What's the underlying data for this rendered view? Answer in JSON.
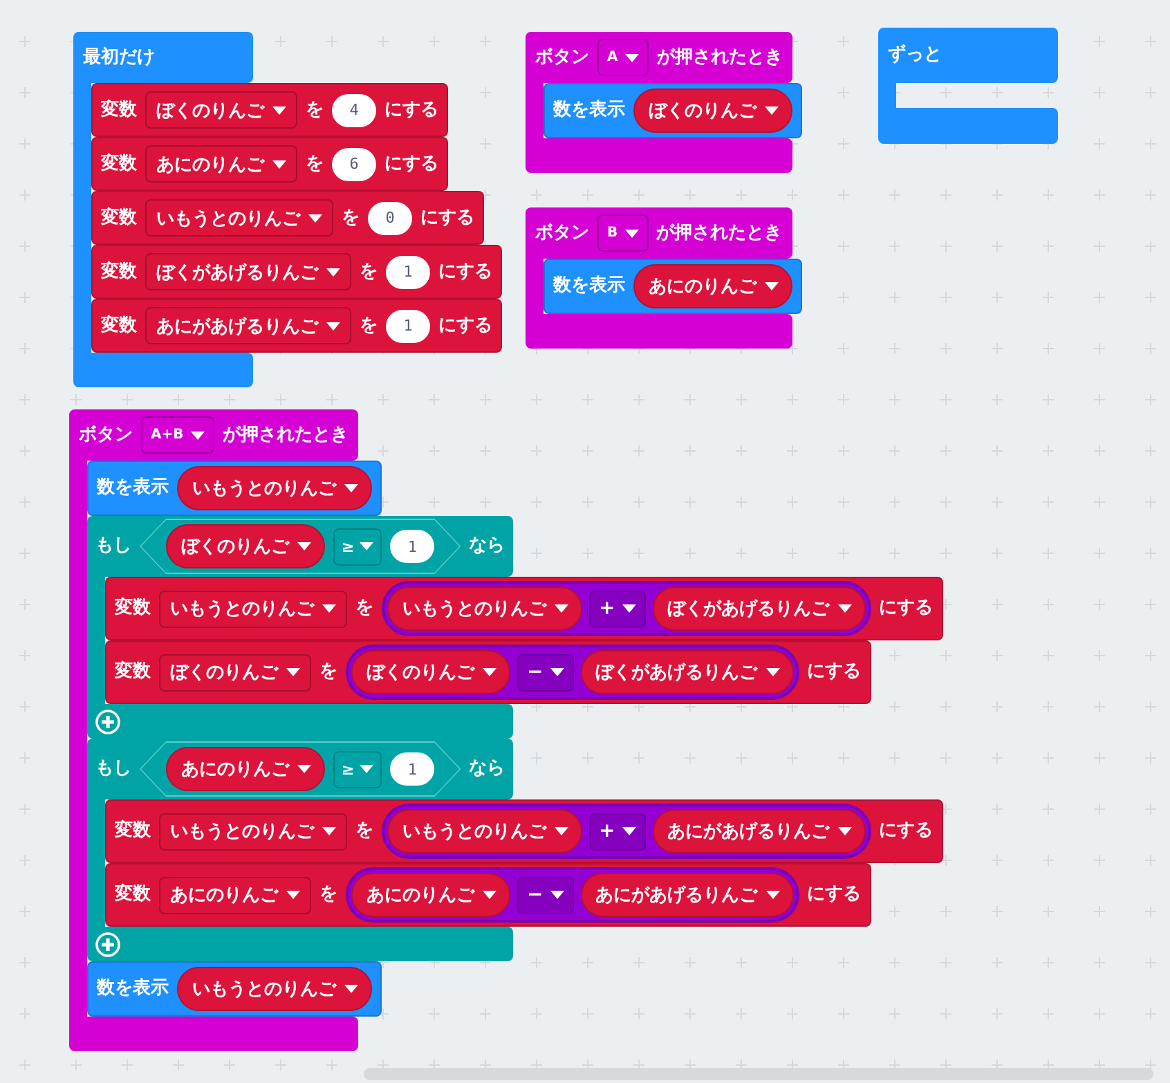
{
  "scripts": [
    {
      "kind": "on_start",
      "label": "最初だけ",
      "body": [
        {
          "kind": "set",
          "label": "変数",
          "variable": "ぼくのりんご",
          "word": "を",
          "value": {
            "kind": "number",
            "text": "4"
          },
          "suffix": "にする"
        },
        {
          "kind": "set",
          "label": "変数",
          "variable": "あにのりんご",
          "word": "を",
          "value": {
            "kind": "number",
            "text": "6"
          },
          "suffix": "にする"
        },
        {
          "kind": "set",
          "label": "変数",
          "variable": "いもうとのりんご",
          "word": "を",
          "value": {
            "kind": "number",
            "text": "0"
          },
          "suffix": "にする"
        },
        {
          "kind": "set",
          "label": "変数",
          "variable": "ぼくがあげるりんご",
          "word": "を",
          "value": {
            "kind": "number",
            "text": "1"
          },
          "suffix": "にする"
        },
        {
          "kind": "set",
          "label": "変数",
          "variable": "あにがあげるりんご",
          "word": "を",
          "value": {
            "kind": "number",
            "text": "1"
          },
          "suffix": "にする"
        }
      ]
    },
    {
      "kind": "on_button",
      "label": "ボタン",
      "button": "A",
      "suffix": "が押されたとき",
      "body": [
        {
          "kind": "show_number",
          "label": "数を表示",
          "value": {
            "kind": "variable",
            "name": "ぼくのりんご"
          }
        }
      ]
    },
    {
      "kind": "forever",
      "label": "ずっと"
    },
    {
      "kind": "on_button",
      "label": "ボタン",
      "button": "B",
      "suffix": "が押されたとき",
      "body": [
        {
          "kind": "show_number",
          "label": "数を表示",
          "value": {
            "kind": "variable",
            "name": "あにのりんご"
          }
        }
      ]
    },
    {
      "kind": "on_button",
      "label": "ボタン",
      "button": "A+B",
      "suffix": "が押されたとき",
      "body": [
        {
          "kind": "show_number",
          "label": "数を表示",
          "value": {
            "kind": "variable",
            "name": "いもうとのりんご"
          }
        },
        {
          "kind": "if",
          "label": "もし",
          "condition": {
            "kind": "compare",
            "left": {
              "kind": "variable",
              "name": "ぼくのりんご"
            },
            "operator": "≥",
            "right": {
              "kind": "number",
              "text": "1"
            }
          },
          "then_label": "なら",
          "body": [
            {
              "kind": "set",
              "label": "変数",
              "variable": "いもうとのりんご",
              "word": "を",
              "value": {
                "kind": "arithmetic",
                "left": {
                  "kind": "variable",
                  "name": "いもうとのりんご"
                },
                "operator": "+",
                "right": {
                  "kind": "variable",
                  "name": "ぼくがあげるりんご"
                }
              },
              "suffix": "にする"
            },
            {
              "kind": "set",
              "label": "変数",
              "variable": "ぼくのりんご",
              "word": "を",
              "value": {
                "kind": "arithmetic",
                "left": {
                  "kind": "variable",
                  "name": "ぼくのりんご"
                },
                "operator": "−",
                "right": {
                  "kind": "variable",
                  "name": "ぼくがあげるりんご"
                }
              },
              "suffix": "にする"
            }
          ]
        },
        {
          "kind": "if",
          "label": "もし",
          "condition": {
            "kind": "compare",
            "left": {
              "kind": "variable",
              "name": "あにのりんご"
            },
            "operator": "≥",
            "right": {
              "kind": "number",
              "text": "1"
            }
          },
          "then_label": "なら",
          "body": [
            {
              "kind": "set",
              "label": "変数",
              "variable": "いもうとのりんご",
              "word": "を",
              "value": {
                "kind": "arithmetic",
                "left": {
                  "kind": "variable",
                  "name": "いもうとのりんご"
                },
                "operator": "+",
                "right": {
                  "kind": "variable",
                  "name": "あにがあげるりんご"
                }
              },
              "suffix": "にする"
            },
            {
              "kind": "set",
              "label": "変数",
              "variable": "あにのりんご",
              "word": "を",
              "value": {
                "kind": "arithmetic",
                "left": {
                  "kind": "variable",
                  "name": "あにのりんご"
                },
                "operator": "−",
                "right": {
                  "kind": "variable",
                  "name": "あにがあげるりんご"
                }
              },
              "suffix": "にする"
            }
          ]
        },
        {
          "kind": "show_number",
          "label": "数を表示",
          "value": {
            "kind": "variable",
            "name": "いもうとのりんご"
          }
        }
      ]
    }
  ]
}
